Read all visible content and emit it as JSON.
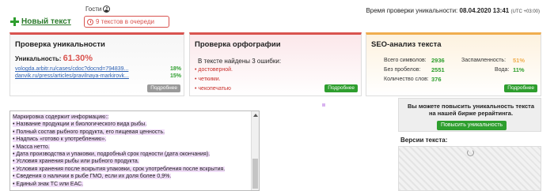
{
  "header": {
    "new_text_label": "Новый текст",
    "guests_label": "Гости",
    "queue_text": "9 текстов в очереди",
    "check_time_label": "Время проверки уникальности:",
    "check_time_value": "08.04.2020 13:41",
    "timezone": "(UTC +03:00)"
  },
  "uniqueness": {
    "title": "Проверка уникальности",
    "label": "Уникальность:",
    "value": "61.30%",
    "sources": [
      {
        "url": "vologda.arbitr.ru/cases/cdoc?docnd=794839...",
        "percent": "18%"
      },
      {
        "url": "danvik.ru/press/articles/pravilnaya-markirovk...",
        "percent": "15%"
      }
    ],
    "more_button": "Подробнее"
  },
  "spelling": {
    "title": "Проверка орфографии",
    "errors_heading": "В тексте найдены 3 ошибки:",
    "errors": [
      "достоверной.",
      "четкими.",
      "чекопечатью"
    ],
    "more_button": "Подробнее"
  },
  "seo": {
    "title": "SEO-анализ текста",
    "total_chars_label": "Всего символов:",
    "total_chars": "2936",
    "no_spaces_label": "Без пробелов:",
    "no_spaces": "2551",
    "words_label": "Количество слов:",
    "words": "376",
    "spam_label": "Заспамленность:",
    "spam": "51%",
    "water_label": "Вода:",
    "water": "11%",
    "more_button": "Подробнее"
  },
  "editor": {
    "lines": [
      "Маркировка содержит информацию::",
      "• Название продукции и биологического вида рыбы.",
      "• Полный состав рыбного продукта, его пищевая ценность.",
      "• Надпись «готово к употреблению».",
      "• Масса нетто.",
      "• Дата производства и упаковки, подробный срок годности (дата окончания).",
      "• Условия хранения рыбы или рыбного продукта.",
      "• Условия хранения после вскрытия упаковки, срок употребления после вскрытия.",
      "• Сведения о наличии в рыбе ГМО, если их доля более 0,9%.",
      "• Единый знак ТС или ЕАС."
    ]
  },
  "rewrite": {
    "text": "Вы можете повысить уникальность текста на нашей бирже рерайтинга.",
    "button": "Повысить уникальность"
  },
  "versions": {
    "label": "Версии текста:"
  },
  "colors": {
    "accent_red": "#d9534f",
    "accent_green": "#2e9e2e",
    "accent_orange": "#f0ad4e",
    "highlight_purple": "#f1def9"
  }
}
